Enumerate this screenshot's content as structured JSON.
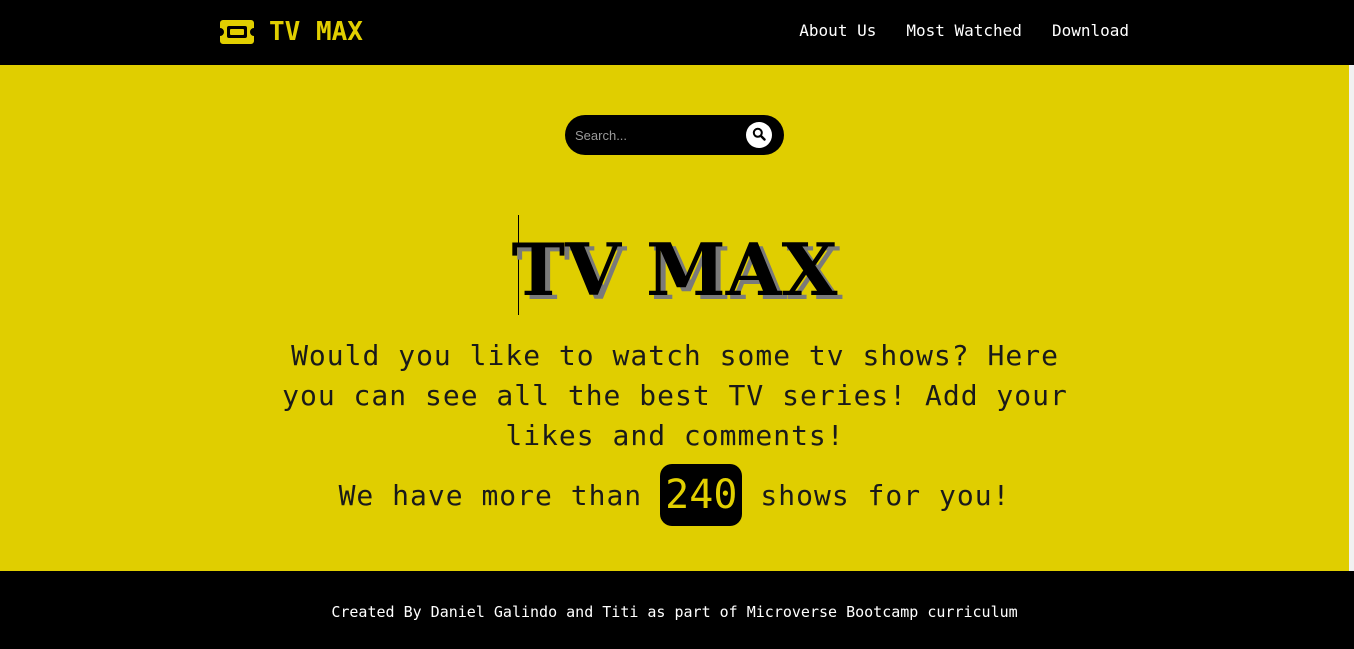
{
  "header": {
    "brand_name": "TV MAX",
    "brand_icon": "ticket-icon",
    "nav": [
      {
        "label": "About Us"
      },
      {
        "label": "Most Watched"
      },
      {
        "label": "Download"
      }
    ]
  },
  "search": {
    "placeholder": "Search...",
    "value": "",
    "icon": "search-icon"
  },
  "hero": {
    "title": "TV MAX",
    "description": "Would you like to watch some tv shows? Here you can see all the best TV series! Add your likes and comments!",
    "count_prefix": "We have more than",
    "count_value": "240",
    "count_suffix": "shows for you!"
  },
  "footer": {
    "text": "Created By Daniel Galindo and Titi as part of Microverse Bootcamp curriculum"
  },
  "colors": {
    "accent": "#e0ce00",
    "dark": "#000000",
    "light": "#ffffff"
  }
}
